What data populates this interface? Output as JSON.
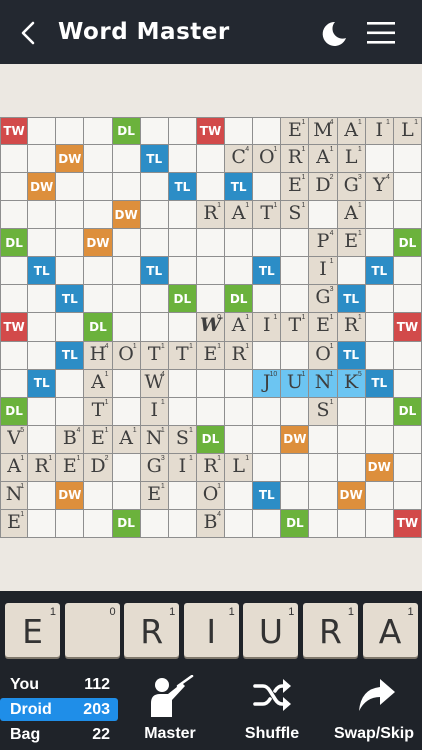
{
  "header": {
    "title": "Word Master",
    "background": "#232830"
  },
  "board": {
    "size": 15,
    "bonuses": [
      {
        "r": 0,
        "c": 0,
        "t": "TW"
      },
      {
        "r": 0,
        "c": 4,
        "t": "DL"
      },
      {
        "r": 0,
        "c": 7,
        "t": "TW"
      },
      {
        "r": 1,
        "c": 2,
        "t": "DW"
      },
      {
        "r": 1,
        "c": 5,
        "t": "TL"
      },
      {
        "r": 2,
        "c": 1,
        "t": "DW"
      },
      {
        "r": 2,
        "c": 6,
        "t": "TL"
      },
      {
        "r": 2,
        "c": 8,
        "t": "TL"
      },
      {
        "r": 3,
        "c": 4,
        "t": "DW"
      },
      {
        "r": 4,
        "c": 0,
        "t": "DL"
      },
      {
        "r": 4,
        "c": 3,
        "t": "DW"
      },
      {
        "r": 4,
        "c": 14,
        "t": "DL"
      },
      {
        "r": 5,
        "c": 1,
        "t": "TL"
      },
      {
        "r": 5,
        "c": 5,
        "t": "TL"
      },
      {
        "r": 5,
        "c": 9,
        "t": "TL"
      },
      {
        "r": 5,
        "c": 13,
        "t": "TL"
      },
      {
        "r": 6,
        "c": 2,
        "t": "TL"
      },
      {
        "r": 6,
        "c": 6,
        "t": "DL"
      },
      {
        "r": 6,
        "c": 8,
        "t": "DL"
      },
      {
        "r": 6,
        "c": 12,
        "t": "TL"
      },
      {
        "r": 7,
        "c": 0,
        "t": "TW"
      },
      {
        "r": 7,
        "c": 3,
        "t": "DL"
      },
      {
        "r": 7,
        "c": 14,
        "t": "TW"
      },
      {
        "r": 8,
        "c": 2,
        "t": "TL"
      },
      {
        "r": 8,
        "c": 12,
        "t": "TL"
      },
      {
        "r": 9,
        "c": 1,
        "t": "TL"
      },
      {
        "r": 9,
        "c": 13,
        "t": "TL"
      },
      {
        "r": 10,
        "c": 0,
        "t": "DL"
      },
      {
        "r": 10,
        "c": 14,
        "t": "DL"
      },
      {
        "r": 11,
        "c": 7,
        "t": "DL"
      },
      {
        "r": 11,
        "c": 10,
        "t": "DW"
      },
      {
        "r": 12,
        "c": 13,
        "t": "DW"
      },
      {
        "r": 13,
        "c": 2,
        "t": "DW"
      },
      {
        "r": 13,
        "c": 9,
        "t": "TL"
      },
      {
        "r": 13,
        "c": 12,
        "t": "DW"
      },
      {
        "r": 14,
        "c": 4,
        "t": "DL"
      },
      {
        "r": 14,
        "c": 10,
        "t": "DL"
      },
      {
        "r": 14,
        "c": 14,
        "t": "TW"
      }
    ],
    "tiles": [
      {
        "r": 0,
        "c": 10,
        "l": "E",
        "p": "1"
      },
      {
        "r": 0,
        "c": 11,
        "l": "M",
        "p": "4"
      },
      {
        "r": 0,
        "c": 12,
        "l": "A",
        "p": "1"
      },
      {
        "r": 0,
        "c": 13,
        "l": "I",
        "p": "1"
      },
      {
        "r": 0,
        "c": 14,
        "l": "L",
        "p": "1"
      },
      {
        "r": 1,
        "c": 8,
        "l": "C",
        "p": "4"
      },
      {
        "r": 1,
        "c": 9,
        "l": "O",
        "p": "1"
      },
      {
        "r": 1,
        "c": 10,
        "l": "R",
        "p": "1"
      },
      {
        "r": 1,
        "c": 11,
        "l": "A",
        "p": "1"
      },
      {
        "r": 1,
        "c": 12,
        "l": "L",
        "p": "1"
      },
      {
        "r": 2,
        "c": 10,
        "l": "E",
        "p": "1"
      },
      {
        "r": 2,
        "c": 11,
        "l": "D",
        "p": "2"
      },
      {
        "r": 2,
        "c": 12,
        "l": "G",
        "p": "3"
      },
      {
        "r": 2,
        "c": 13,
        "l": "Y",
        "p": "4"
      },
      {
        "r": 3,
        "c": 7,
        "l": "R",
        "p": "1"
      },
      {
        "r": 3,
        "c": 8,
        "l": "A",
        "p": "1"
      },
      {
        "r": 3,
        "c": 9,
        "l": "T",
        "p": "1"
      },
      {
        "r": 3,
        "c": 10,
        "l": "S",
        "p": "1"
      },
      {
        "r": 3,
        "c": 12,
        "l": "A",
        "p": "1"
      },
      {
        "r": 4,
        "c": 11,
        "l": "P",
        "p": "4"
      },
      {
        "r": 4,
        "c": 12,
        "l": "E",
        "p": "1"
      },
      {
        "r": 5,
        "c": 11,
        "l": "I",
        "p": "1"
      },
      {
        "r": 6,
        "c": 11,
        "l": "G",
        "p": "3"
      },
      {
        "r": 7,
        "c": 7,
        "l": "W",
        "p": "0",
        "blank": true
      },
      {
        "r": 7,
        "c": 8,
        "l": "A",
        "p": "1"
      },
      {
        "r": 7,
        "c": 9,
        "l": "I",
        "p": "1"
      },
      {
        "r": 7,
        "c": 10,
        "l": "T",
        "p": "1"
      },
      {
        "r": 7,
        "c": 11,
        "l": "E",
        "p": "1"
      },
      {
        "r": 7,
        "c": 12,
        "l": "R",
        "p": "1"
      },
      {
        "r": 8,
        "c": 3,
        "l": "H",
        "p": "4"
      },
      {
        "r": 8,
        "c": 4,
        "l": "O",
        "p": "1"
      },
      {
        "r": 8,
        "c": 5,
        "l": "T",
        "p": "1"
      },
      {
        "r": 8,
        "c": 6,
        "l": "T",
        "p": "1"
      },
      {
        "r": 8,
        "c": 7,
        "l": "E",
        "p": "1"
      },
      {
        "r": 8,
        "c": 8,
        "l": "R",
        "p": "1"
      },
      {
        "r": 8,
        "c": 11,
        "l": "O",
        "p": "1"
      },
      {
        "r": 9,
        "c": 3,
        "l": "A",
        "p": "1"
      },
      {
        "r": 9,
        "c": 5,
        "l": "W",
        "p": "4"
      },
      {
        "r": 9,
        "c": 9,
        "l": "J",
        "p": "10",
        "hl": true
      },
      {
        "r": 9,
        "c": 10,
        "l": "U",
        "p": "1",
        "hl": true
      },
      {
        "r": 9,
        "c": 11,
        "l": "N",
        "p": "1",
        "hl": true
      },
      {
        "r": 9,
        "c": 12,
        "l": "K",
        "p": "5",
        "hl": true
      },
      {
        "r": 10,
        "c": 3,
        "l": "T",
        "p": "1"
      },
      {
        "r": 10,
        "c": 5,
        "l": "I",
        "p": "1"
      },
      {
        "r": 10,
        "c": 11,
        "l": "S",
        "p": "1"
      },
      {
        "r": 11,
        "c": 0,
        "l": "V",
        "p": "5"
      },
      {
        "r": 11,
        "c": 2,
        "l": "B",
        "p": "4"
      },
      {
        "r": 11,
        "c": 3,
        "l": "E",
        "p": "1"
      },
      {
        "r": 11,
        "c": 4,
        "l": "A",
        "p": "1"
      },
      {
        "r": 11,
        "c": 5,
        "l": "N",
        "p": "1"
      },
      {
        "r": 11,
        "c": 6,
        "l": "S",
        "p": "1"
      },
      {
        "r": 12,
        "c": 0,
        "l": "A",
        "p": "1"
      },
      {
        "r": 12,
        "c": 1,
        "l": "R",
        "p": "1"
      },
      {
        "r": 12,
        "c": 2,
        "l": "E",
        "p": "1"
      },
      {
        "r": 12,
        "c": 3,
        "l": "D",
        "p": "2"
      },
      {
        "r": 12,
        "c": 5,
        "l": "G",
        "p": "3"
      },
      {
        "r": 12,
        "c": 6,
        "l": "I",
        "p": "1"
      },
      {
        "r": 12,
        "c": 7,
        "l": "R",
        "p": "1"
      },
      {
        "r": 12,
        "c": 8,
        "l": "L",
        "p": "1"
      },
      {
        "r": 13,
        "c": 0,
        "l": "N",
        "p": "1"
      },
      {
        "r": 13,
        "c": 5,
        "l": "E",
        "p": "1"
      },
      {
        "r": 13,
        "c": 7,
        "l": "O",
        "p": "1"
      },
      {
        "r": 14,
        "c": 0,
        "l": "E",
        "p": "1"
      },
      {
        "r": 14,
        "c": 7,
        "l": "B",
        "p": "4"
      }
    ]
  },
  "rack": [
    {
      "l": "E",
      "p": "1"
    },
    {
      "l": "",
      "p": "0"
    },
    {
      "l": "R",
      "p": "1"
    },
    {
      "l": "I",
      "p": "1"
    },
    {
      "l": "U",
      "p": "1"
    },
    {
      "l": "R",
      "p": "1"
    },
    {
      "l": "A",
      "p": "1"
    }
  ],
  "scores": [
    {
      "name": "You",
      "value": "112",
      "active": false
    },
    {
      "name": "Droid",
      "value": "203",
      "active": true
    },
    {
      "name": "Bag",
      "value": "22",
      "active": false
    }
  ],
  "actions": {
    "master": "Master",
    "shuffle": "Shuffle",
    "swap": "Swap/Skip"
  },
  "colors": {
    "tw": "#d24a4a",
    "dw": "#dd8f3c",
    "tl": "#2c8dc6",
    "dl": "#6bb23c",
    "tile": "#e4dcd0",
    "highlight": "#6cc5f2",
    "active": "#1f8ee8"
  }
}
